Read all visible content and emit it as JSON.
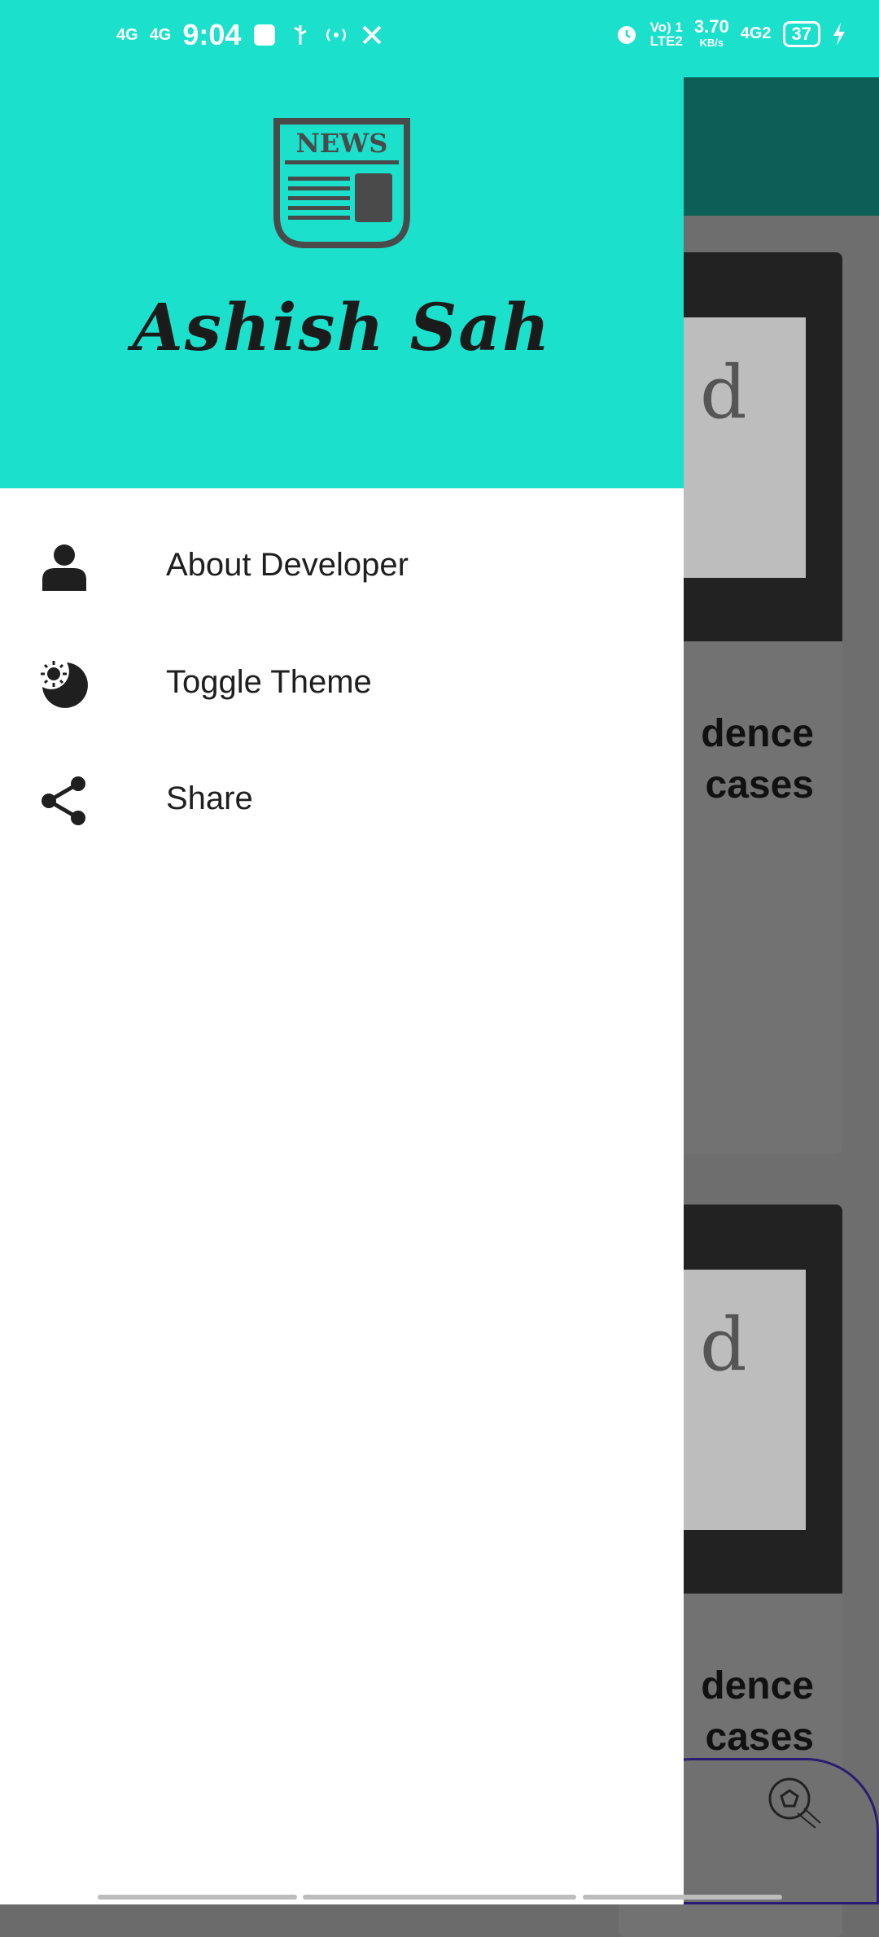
{
  "status_bar": {
    "signal1": "4G",
    "signal2": "4G",
    "time": "9:04",
    "volte": "Vo) 1",
    "lte": "LTE2",
    "speed": "3.70",
    "speed_unit": "KB/s",
    "net": "4G2",
    "battery": "37"
  },
  "drawer": {
    "logo_text": "NEWS",
    "developer_name": "Ashish Sah",
    "menu": [
      {
        "label": "About Developer",
        "icon": "person-icon"
      },
      {
        "label": "Toggle Theme",
        "icon": "theme-icon"
      },
      {
        "label": "Share",
        "icon": "share-icon"
      }
    ]
  },
  "background": {
    "cards": [
      {
        "line1": "dence",
        "line2": "cases"
      },
      {
        "line1": "dence",
        "line2": "cases"
      }
    ]
  },
  "colors": {
    "accent": "#1ae0cc",
    "toolbar": "#0b5f56",
    "text": "#1f1f1f"
  }
}
